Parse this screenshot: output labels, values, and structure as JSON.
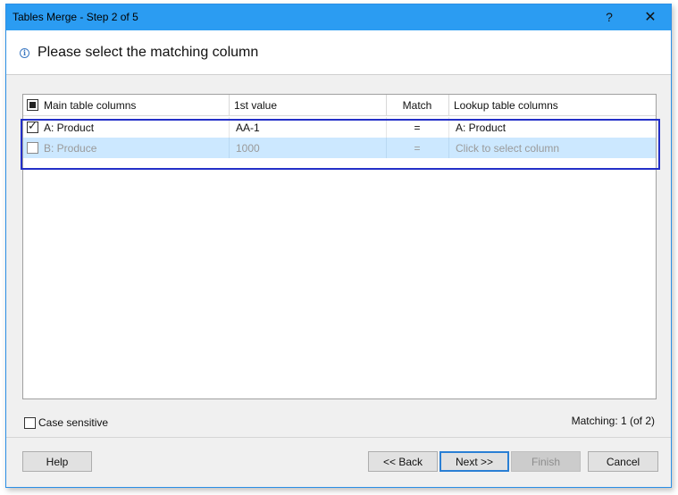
{
  "window": {
    "title": "Tables Merge - Step 2 of 5",
    "help_glyph": "?",
    "close_glyph": "✕"
  },
  "header": {
    "icon": "info-icon",
    "title": "Please select the matching column"
  },
  "grid": {
    "columns": [
      "Main table columns",
      "1st value",
      "Match",
      "Lookup table columns"
    ],
    "header_checkbox_state": "indeterminate",
    "rows": [
      {
        "checked": true,
        "main": "A: Product",
        "first_value": "AA-1",
        "match": "=",
        "lookup": "A: Product"
      },
      {
        "checked": false,
        "main": "B: Produce",
        "first_value": "1000",
        "match": "=",
        "lookup": "Click to select column"
      }
    ]
  },
  "options": {
    "case_sensitive_label": "Case sensitive",
    "case_sensitive_checked": false
  },
  "status": {
    "matching_text": "Matching: 1 (of 2)"
  },
  "buttons": {
    "help": "Help",
    "back": "<< Back",
    "next": "Next >>",
    "finish": "Finish",
    "cancel": "Cancel"
  },
  "colors": {
    "titlebar": "#2b9cf2",
    "selected_row": "#cce8ff",
    "highlight_box": "#2430c8"
  }
}
